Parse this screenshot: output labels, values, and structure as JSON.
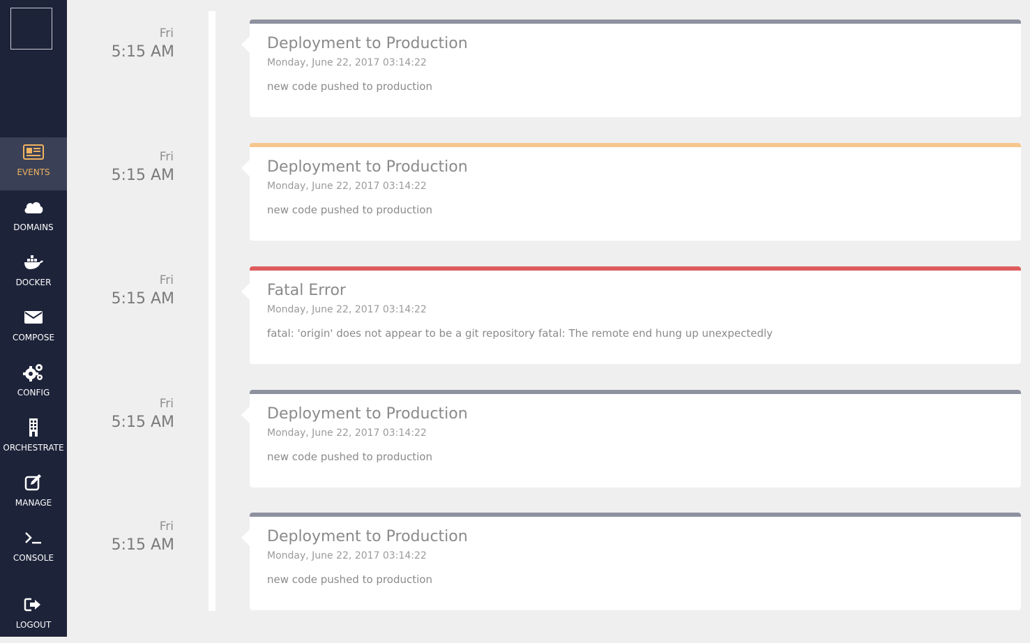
{
  "sidebar": {
    "items": [
      {
        "label": "EVENTS",
        "icon": "newspaper-icon",
        "active": true
      },
      {
        "label": "DOMAINS",
        "icon": "cloud-icon",
        "active": false
      },
      {
        "label": "DOCKER",
        "icon": "docker-icon",
        "active": false
      },
      {
        "label": "COMPOSE",
        "icon": "envelope-icon",
        "active": false
      },
      {
        "label": "CONFIG",
        "icon": "gears-icon",
        "active": false
      },
      {
        "label": "ORCHESTRATE",
        "icon": "building-icon",
        "active": false
      },
      {
        "label": "MANAGE",
        "icon": "edit-icon",
        "active": false
      },
      {
        "label": "CONSOLE",
        "icon": "terminal-icon",
        "active": false
      },
      {
        "label": "LOGOUT",
        "icon": "sign-out-icon",
        "active": false
      }
    ]
  },
  "colors": {
    "sidebar_bg": "#1d2339",
    "active_bg": "#3a4156",
    "accent": "#f0b260",
    "status_default": "#8e919f",
    "status_warning": "#f5c78e",
    "status_error": "#de5c5c"
  },
  "events": [
    {
      "day": "Fri",
      "time": "5:15 AM",
      "title": "Deployment to Production",
      "date": "Monday, June 22, 2017 03:14:22",
      "message": "new code pushed to production",
      "status": "default"
    },
    {
      "day": "Fri",
      "time": "5:15 AM",
      "title": "Deployment to Production",
      "date": "Monday, June 22, 2017 03:14:22",
      "message": "new code pushed to production",
      "status": "warning"
    },
    {
      "day": "Fri",
      "time": "5:15 AM",
      "title": "Fatal Error",
      "date": "Monday, June 22, 2017 03:14:22",
      "message": "fatal: 'origin' does not appear to be a git repository fatal: The remote end hung up unexpectedly",
      "status": "error"
    },
    {
      "day": "Fri",
      "time": "5:15 AM",
      "title": "Deployment to Production",
      "date": "Monday, June 22, 2017 03:14:22",
      "message": "new code pushed to production",
      "status": "default"
    },
    {
      "day": "Fri",
      "time": "5:15 AM",
      "title": "Deployment to Production",
      "date": "Monday, June 22, 2017 03:14:22",
      "message": "new code pushed to production",
      "status": "default"
    }
  ]
}
